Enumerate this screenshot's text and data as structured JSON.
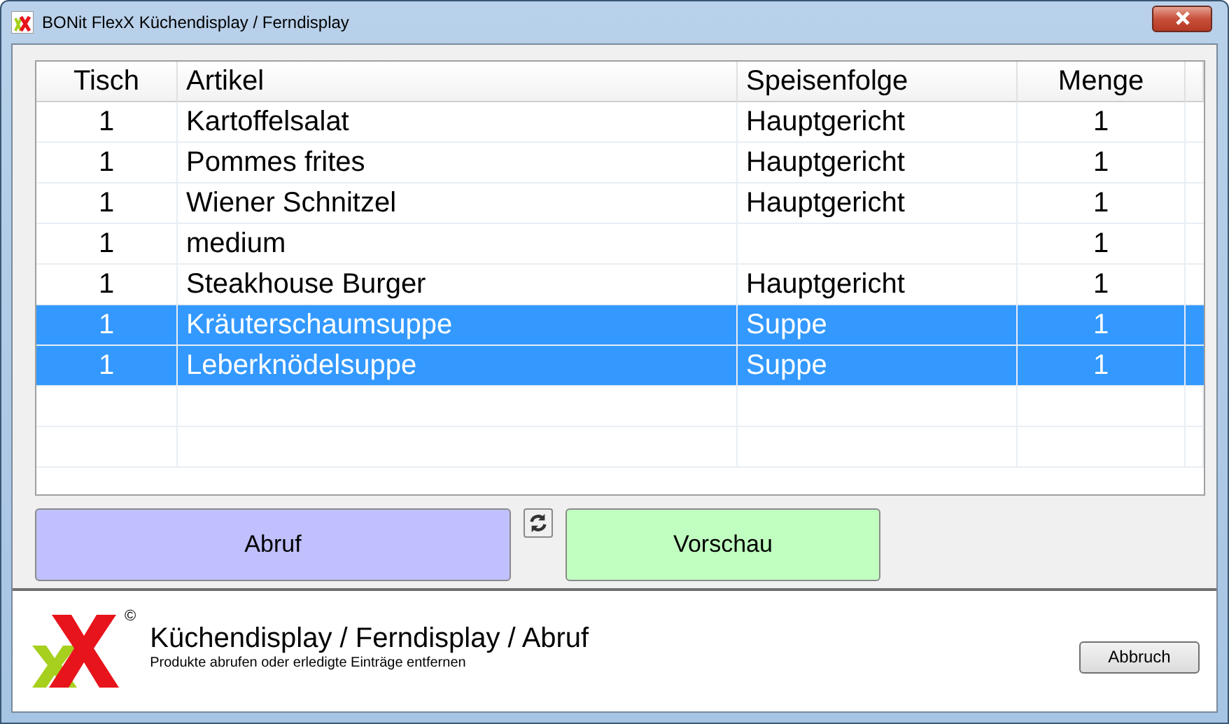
{
  "window": {
    "title": "BONit FlexX Küchendisplay / Ferndisplay"
  },
  "table": {
    "columns": [
      "Tisch",
      "Artikel",
      "Speisenfolge",
      "Menge"
    ],
    "rows": [
      {
        "cells": [
          "1",
          "Kartoffelsalat",
          "Hauptgericht",
          "1"
        ],
        "selected": false
      },
      {
        "cells": [
          "1",
          "Pommes frites",
          "Hauptgericht",
          "1"
        ],
        "selected": false
      },
      {
        "cells": [
          "1",
          "Wiener Schnitzel",
          "Hauptgericht",
          "1"
        ],
        "selected": false
      },
      {
        "cells": [
          "1",
          "medium",
          "",
          "1"
        ],
        "selected": false
      },
      {
        "cells": [
          "1",
          "Steakhouse Burger",
          "Hauptgericht",
          "1"
        ],
        "selected": false
      },
      {
        "cells": [
          "1",
          "Kräuterschaumsuppe",
          "Suppe",
          "1"
        ],
        "selected": true
      },
      {
        "cells": [
          "1",
          "Leberknödelsuppe",
          "Suppe",
          "1"
        ],
        "selected": true
      }
    ]
  },
  "actions": [
    {
      "label": "Abruf",
      "color": "#c0c0ff"
    },
    {
      "label": "Vorschau",
      "color": "#c0ffc0"
    }
  ],
  "footer": {
    "title": "Küchendisplay / Ferndisplay / Abruf",
    "subtitle": "Produkte abrufen oder erledigte Einträge entfernen",
    "copyright": "©",
    "cancel": "Abbruch"
  }
}
